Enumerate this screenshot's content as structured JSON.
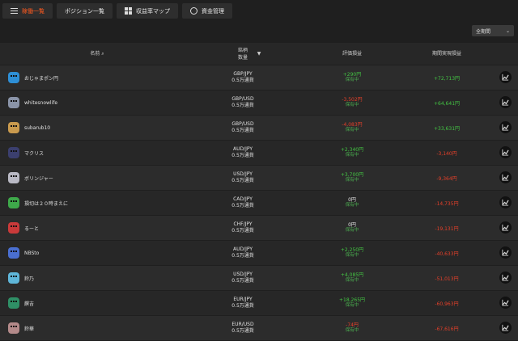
{
  "tabs": [
    {
      "label": "稼働一覧",
      "active": true
    },
    {
      "label": "ポジション一覧",
      "active": false
    },
    {
      "label": "収益率マップ",
      "active": false
    },
    {
      "label": "資金管理",
      "active": false
    }
  ],
  "period_select": {
    "value": "全期間"
  },
  "table_header": {
    "name": "名前",
    "pair_line1": "銘柄",
    "pair_line2": "数量",
    "eval": "評価損益",
    "realized": "期間実現損益"
  },
  "rows": [
    {
      "name": "おじゃまポン円",
      "pair": "GBP/JPY",
      "qty": "0.5万通貨",
      "eval": "+290円",
      "status": "保有中",
      "eval_sign": "pos",
      "realized": "+72,713円",
      "realized_sign": "pos",
      "avatar_color": "#2e8fd6"
    },
    {
      "name": "whitesnowlife",
      "pair": "GBP/USD",
      "qty": "0.5万通貨",
      "eval": "-3,502円",
      "status": "保有中",
      "eval_sign": "neg",
      "realized": "+64,641円",
      "realized_sign": "pos",
      "avatar_color": "#8a94a8"
    },
    {
      "name": "subarub10",
      "pair": "GBP/USD",
      "qty": "0.5万通貨",
      "eval": "-4,083円",
      "status": "保有中",
      "eval_sign": "neg",
      "realized": "+33,631円",
      "realized_sign": "pos",
      "avatar_color": "#c99a4e"
    },
    {
      "name": "マクリス",
      "pair": "AUD/JPY",
      "qty": "0.5万通貨",
      "eval": "+2,340円",
      "status": "保有中",
      "eval_sign": "pos",
      "realized": "-3,140円",
      "realized_sign": "neg",
      "avatar_color": "#3b3f6e"
    },
    {
      "name": "ボリンジャー",
      "pair": "USD/JPY",
      "qty": "0.5万通貨",
      "eval": "+3,700円",
      "status": "保有中",
      "eval_sign": "pos",
      "realized": "-9,364円",
      "realized_sign": "neg",
      "avatar_color": "#b9b9c4"
    },
    {
      "name": "損切は２０時まえに",
      "pair": "CAD/JPY",
      "qty": "0.5万通貨",
      "eval": "0円",
      "status": "保有中",
      "eval_sign": "zero",
      "realized": "-14,735円",
      "realized_sign": "neg",
      "avatar_color": "#3ea84a"
    },
    {
      "name": "るーと",
      "pair": "CHF/JPY",
      "qty": "0.5万通貨",
      "eval": "0円",
      "status": "保有中",
      "eval_sign": "zero",
      "realized": "-19,131円",
      "realized_sign": "neg",
      "avatar_color": "#c93a3a"
    },
    {
      "name": "NBSto",
      "pair": "AUD/JPY",
      "qty": "0.5万通貨",
      "eval": "+2,250円",
      "status": "保有中",
      "eval_sign": "pos",
      "realized": "-40,633円",
      "realized_sign": "neg",
      "avatar_color": "#4a6fd0"
    },
    {
      "name": "鈴乃",
      "pair": "USD/JPY",
      "qty": "0.5万通貨",
      "eval": "+4,085円",
      "status": "保有中",
      "eval_sign": "pos",
      "realized": "-51,013円",
      "realized_sign": "neg",
      "avatar_color": "#5fb6d9"
    },
    {
      "name": "饌吉",
      "pair": "EUR/JPY",
      "qty": "0.5万通貨",
      "eval": "+18,265円",
      "status": "保有中",
      "eval_sign": "pos",
      "realized": "-60,963円",
      "realized_sign": "neg",
      "avatar_color": "#2f8f66"
    },
    {
      "name": "鈴華",
      "pair": "EUR/USD",
      "qty": "0.5万通貨",
      "eval": "-74円",
      "status": "保有中",
      "eval_sign": "neg",
      "realized": "-67,616円",
      "realized_sign": "neg",
      "avatar_color": "#b48a8a"
    }
  ]
}
